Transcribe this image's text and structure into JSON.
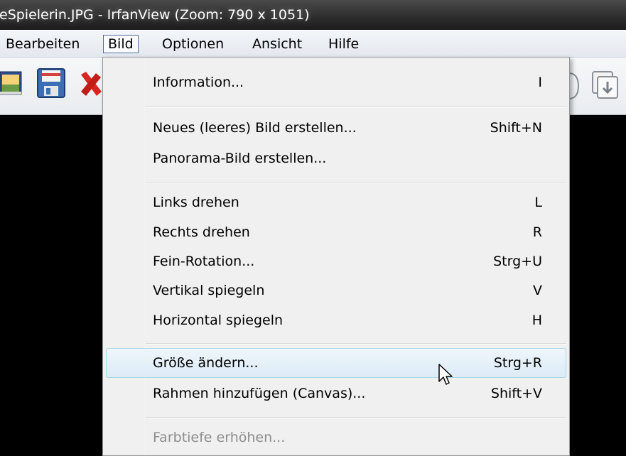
{
  "window": {
    "title": "eSpielerin.JPG - IrfanView (Zoom: 790 x 1051)"
  },
  "menubar": {
    "items": [
      {
        "label": "Bearbeiten"
      },
      {
        "label": "Bild",
        "active": true
      },
      {
        "label": "Optionen"
      },
      {
        "label": "Ansicht"
      },
      {
        "label": "Hilfe"
      }
    ]
  },
  "toolbar": {
    "icons": [
      "image-icon",
      "save-icon",
      "delete-icon",
      "copy-pages-icon"
    ]
  },
  "dropdown": {
    "items": [
      {
        "label": "Information...",
        "shortcut": "I"
      },
      {
        "label": "Neues (leeres) Bild erstellen...",
        "shortcut": "Shift+N"
      },
      {
        "label": "Panorama-Bild erstellen...",
        "shortcut": ""
      },
      {
        "label": "Links drehen",
        "shortcut": "L"
      },
      {
        "label": "Rechts drehen",
        "shortcut": "R"
      },
      {
        "label": "Fein-Rotation...",
        "shortcut": "Strg+U"
      },
      {
        "label": "Vertikal spiegeln",
        "shortcut": "V"
      },
      {
        "label": "Horizontal spiegeln",
        "shortcut": "H"
      },
      {
        "label": "Größe ändern...",
        "shortcut": "Strg+R",
        "highlighted": true
      },
      {
        "label": "Rahmen hinzufügen (Canvas)...",
        "shortcut": "Shift+V"
      },
      {
        "label": "Farbtiefe erhöhen...",
        "shortcut": "",
        "disabled": true
      }
    ]
  },
  "colors": {
    "menu_background": "#f0f0f0",
    "highlight_border": "#a8d8eb",
    "disabled_text": "#8d8d8d",
    "canvas": "#000000"
  }
}
